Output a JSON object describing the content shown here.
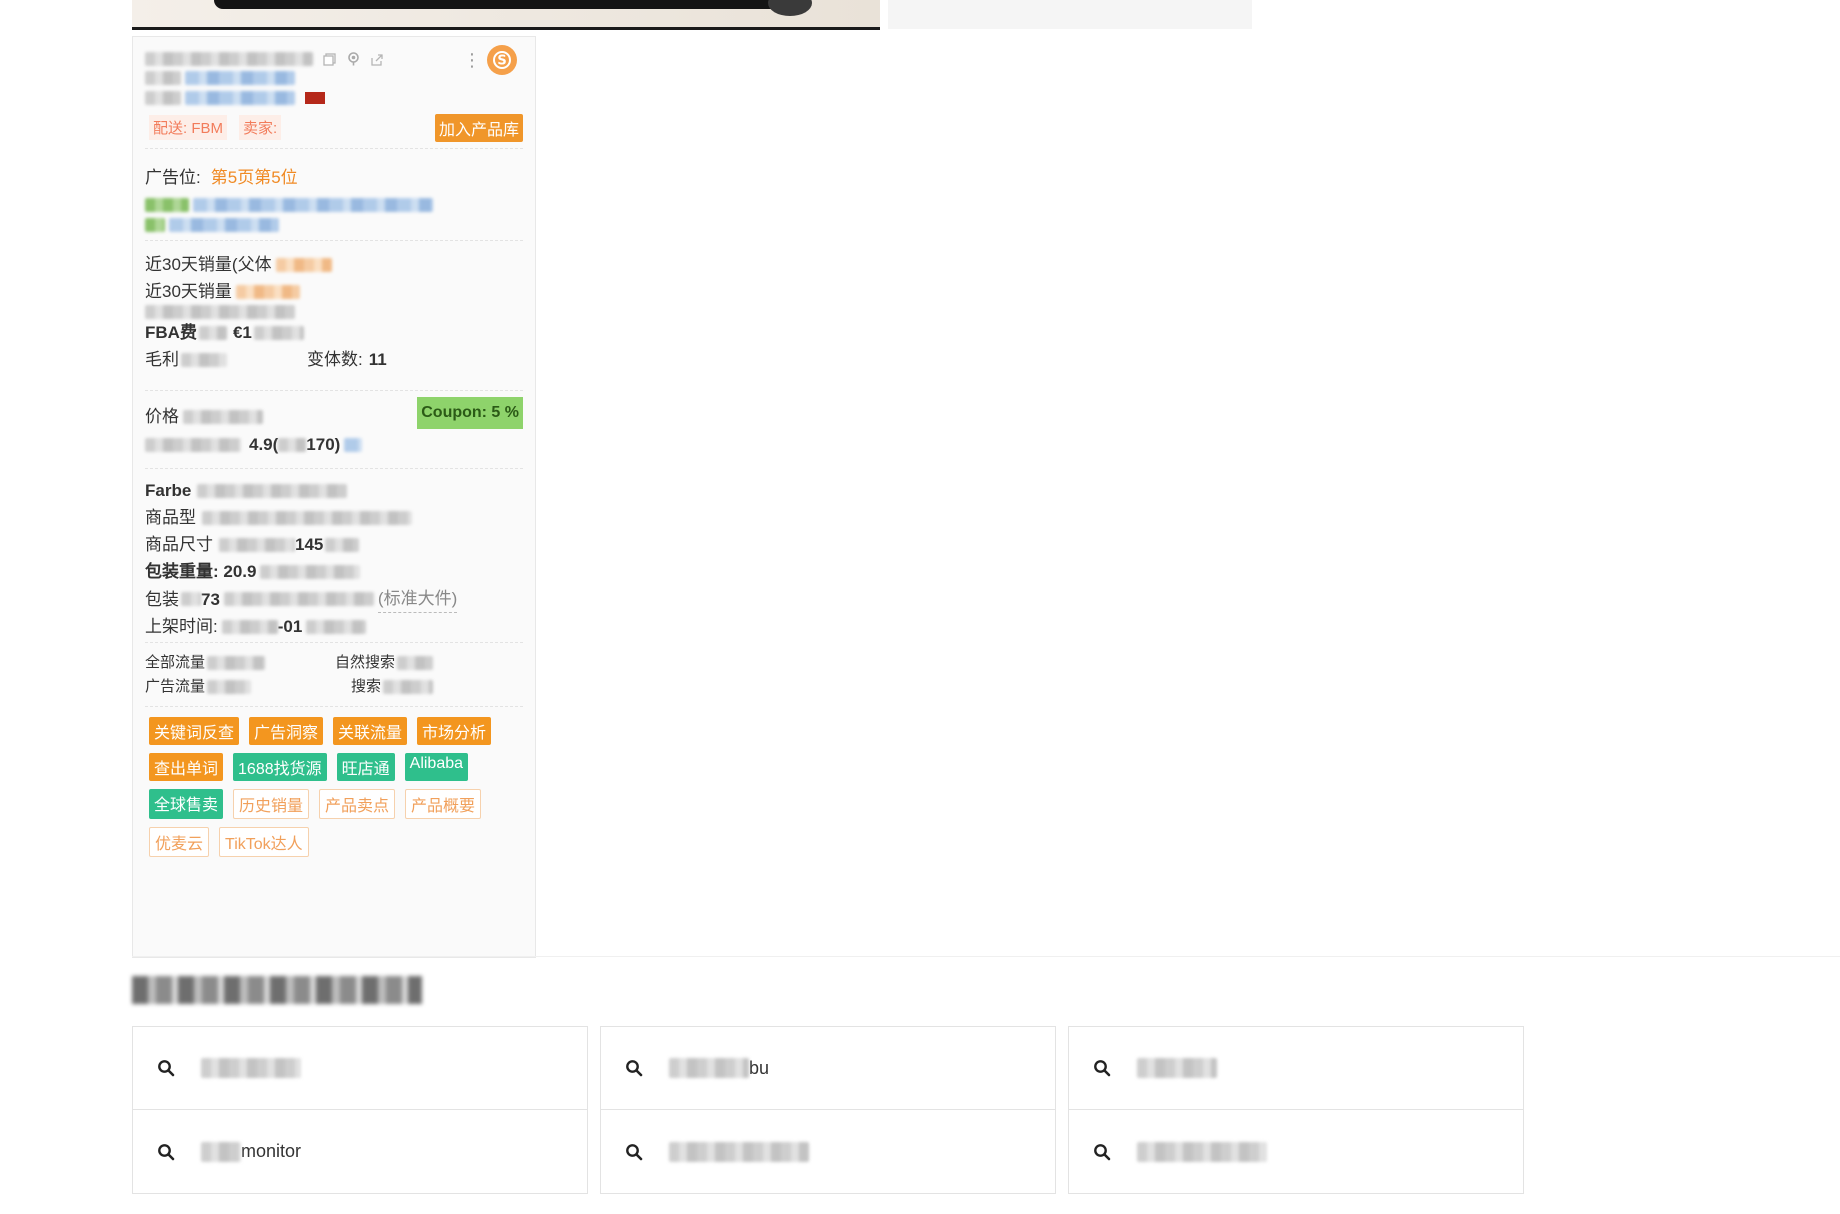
{
  "card": {
    "delivery": "配送: FBM",
    "seller_label": "卖家: ",
    "add_to_library": "加入产品库",
    "ad_position_label": "广告位:",
    "ad_position_value": "第5页第5位",
    "sales_30d_parent_label": "近30天销量(父体",
    "sales_30d_label": "近30天销量",
    "fba_label": "FBA费",
    "fba_value": "€1",
    "margin_label": "毛利",
    "variants_label": "变体数:",
    "variants_value": "11",
    "price_label": "价格",
    "coupon": "Coupon: 5 %",
    "rating_value": "4.9(",
    "rating_tail": "170)",
    "farbe_label": "Farbe",
    "model_label": "商品型",
    "size_label": "商品尺寸",
    "size_tail": "145",
    "weight_label": "包装重量: 20.9",
    "pkg_label": "包装",
    "pkg_value": "73",
    "pkg_tail": "(标准大件)",
    "listed_label": "上架时间:",
    "listed_tail": "-01",
    "all_traffic_label": "全部流量",
    "organic_label": "自然搜索",
    "ad_traffic_label": "广告流量",
    "search_label": "搜索",
    "buttons": [
      {
        "label": "关键词反查",
        "style": "o"
      },
      {
        "label": "广告洞察",
        "style": "o"
      },
      {
        "label": "关联流量",
        "style": "o"
      },
      {
        "label": "市场分析",
        "style": "o"
      },
      {
        "label": "查出单词",
        "style": "o"
      },
      {
        "label": "1688找货源",
        "style": "g"
      },
      {
        "label": "旺店通",
        "style": "g"
      },
      {
        "label": "Alibaba",
        "style": "g"
      },
      {
        "label": "全球售卖",
        "style": "g"
      },
      {
        "label": "历史销量",
        "style": "l"
      },
      {
        "label": "产品卖点",
        "style": "l"
      },
      {
        "label": "产品概要",
        "style": "l"
      },
      {
        "label": "优麦云",
        "style": "l"
      },
      {
        "label": "TikTok达人",
        "style": "l"
      }
    ]
  },
  "related": {
    "items": [
      {
        "text": "",
        "blur_w": 100
      },
      {
        "text": "monitor",
        "blur_w": 40
      },
      {
        "text": "bu",
        "blur_w": 80
      },
      {
        "text": "",
        "blur_w": 140
      },
      {
        "text": "",
        "blur_w": 80
      },
      {
        "text": "",
        "blur_w": 130
      }
    ]
  },
  "colors": {
    "accent_orange": "#f0962a",
    "accent_green": "#2fbf8c",
    "coupon_green": "#8ed36b",
    "logo_orange": "#f5a04a"
  }
}
